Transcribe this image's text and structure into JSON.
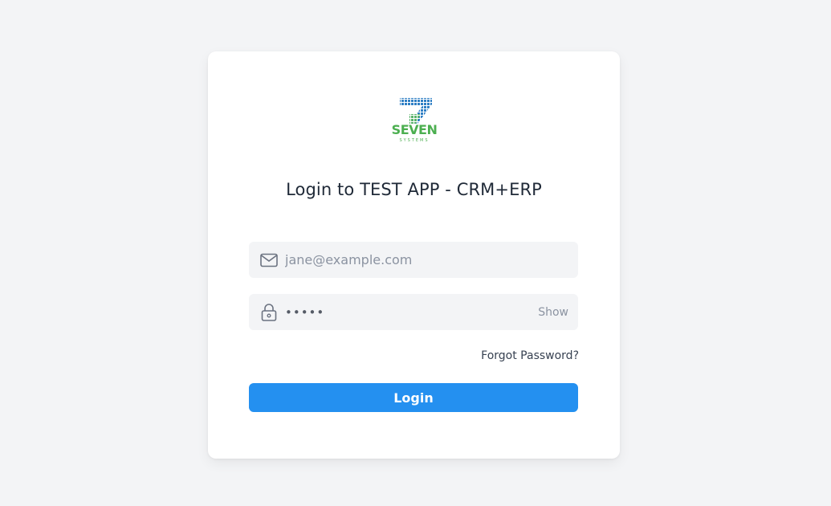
{
  "logo": {
    "brand_text": "SEVEN",
    "sub_text": "SYSTEMS",
    "colors": {
      "top": "#2f7fc4",
      "bottom": "#4caf50"
    }
  },
  "title": "Login to TEST APP - CRM+ERP",
  "email": {
    "placeholder": "jane@example.com",
    "value": "",
    "icon": "mail-icon"
  },
  "password": {
    "value": "•••••",
    "icon": "lock-icon",
    "toggle_label": "Show"
  },
  "forgot_password_label": "Forgot Password?",
  "login_label": "Login",
  "colors": {
    "accent": "#2490f0",
    "background": "#f3f4f6",
    "card": "#ffffff"
  }
}
